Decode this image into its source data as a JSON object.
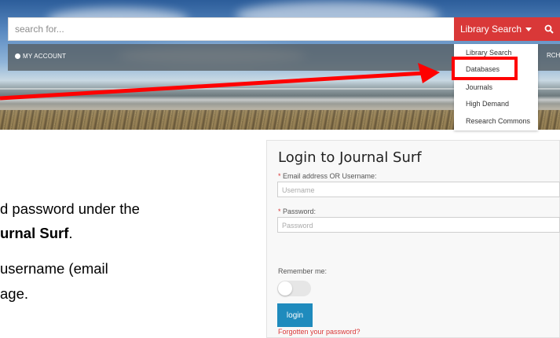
{
  "search": {
    "placeholder": "search for..."
  },
  "library_search": {
    "label": "Library Search"
  },
  "account": {
    "label": "MY ACCOUNT",
    "partial_right": "RCH"
  },
  "dropdown": {
    "items": [
      "Library Search",
      "Databases",
      "Journals",
      "High Demand",
      "Research Commons"
    ],
    "highlighted": "Databases"
  },
  "instructions": {
    "line1_prefix": "d password under the",
    "line2_bold": "urnal Surf",
    "line2_suffix": ".",
    "line3": "username (email",
    "line4": "age."
  },
  "login": {
    "title": "Login to Journal Surf",
    "email_label": "Email address OR Username:",
    "email_placeholder": "Username",
    "password_label": "Password:",
    "password_placeholder": "Password",
    "remember_label": "Remember me:",
    "button_label": "login",
    "forgot_link": "Forgotten your password?"
  },
  "colors": {
    "accent_red": "#d93838",
    "button_blue": "#1f8bbd",
    "highlight_red": "#ff0000"
  }
}
